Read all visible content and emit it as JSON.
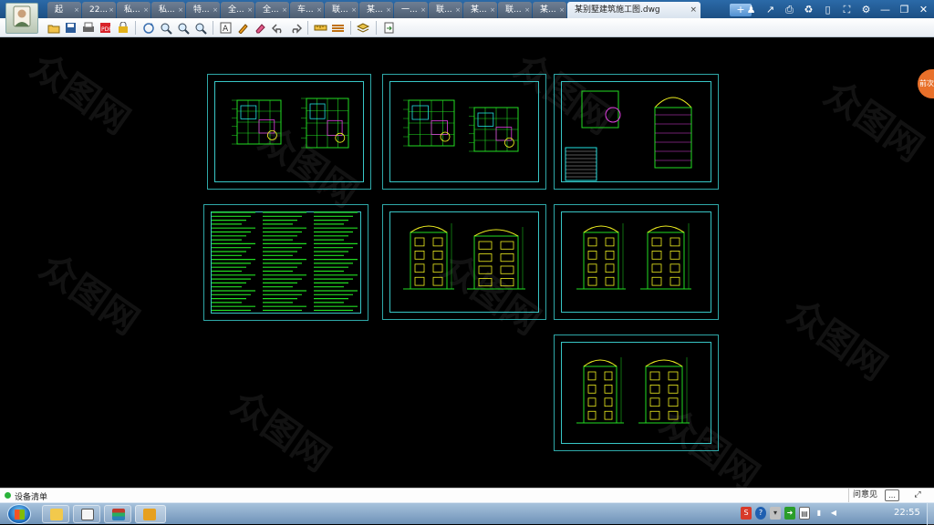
{
  "tabs": [
    {
      "label": "起",
      "active": false
    },
    {
      "label": "22...",
      "active": false
    },
    {
      "label": "私...",
      "active": false
    },
    {
      "label": "私...",
      "active": false
    },
    {
      "label": "特...",
      "active": false
    },
    {
      "label": "全...",
      "active": false
    },
    {
      "label": "全...",
      "active": false
    },
    {
      "label": "车...",
      "active": false
    },
    {
      "label": "联...",
      "active": false
    },
    {
      "label": "某...",
      "active": false
    },
    {
      "label": "一...",
      "active": false
    },
    {
      "label": "联...",
      "active": false
    },
    {
      "label": "某...",
      "active": false
    },
    {
      "label": "联...",
      "active": false
    },
    {
      "label": "某...",
      "active": false
    },
    {
      "label": "某别墅建筑施工图.dwg",
      "active": true
    }
  ],
  "new_tab_label": "+",
  "tab_close_glyph": "×",
  "top_icons": [
    "users-icon",
    "share-icon",
    "print-settings-icon",
    "recycle-icon",
    "phone-icon",
    "fit-screen-icon",
    "gear-icon",
    "minimize-icon",
    "restore-icon",
    "close-icon"
  ],
  "toolbar_icons": [
    "open-icon",
    "save-icon",
    "print-icon",
    "pdf-icon",
    "lock-icon",
    "rotate-icon",
    "zoom-in-icon",
    "zoom-out-icon",
    "zoom-window-icon",
    "text-icon",
    "pencil-icon",
    "eraser-icon",
    "undo-icon",
    "redo-icon",
    "measure-icon",
    "layers-icon",
    "layer-manager-icon",
    "export-icon"
  ],
  "colors": {
    "sheet_border": "#2fa8a8",
    "drawing_green": "#22dd22",
    "drawing_cyan": "#22e0e0",
    "drawing_yellow": "#f0f020",
    "drawing_magenta": "#e040e0",
    "tabbar": "#1c4f84"
  },
  "side_badge": "前次",
  "status": {
    "text": "设备清单",
    "feedback": "问意见",
    "chat_label": "…",
    "fullscreen_label": "⤢"
  },
  "taskbar": {
    "apps": [
      "explorer-icon",
      "avatar-app-icon",
      "books-icon",
      "cad-viewer-icon"
    ],
    "tray": [
      "s-icon",
      "help-icon",
      "shield-icon",
      "green-arrow-icon",
      "clipboard-icon",
      "network-icon",
      "volume-icon"
    ],
    "clock": "22:55"
  },
  "watermark": "众图网"
}
